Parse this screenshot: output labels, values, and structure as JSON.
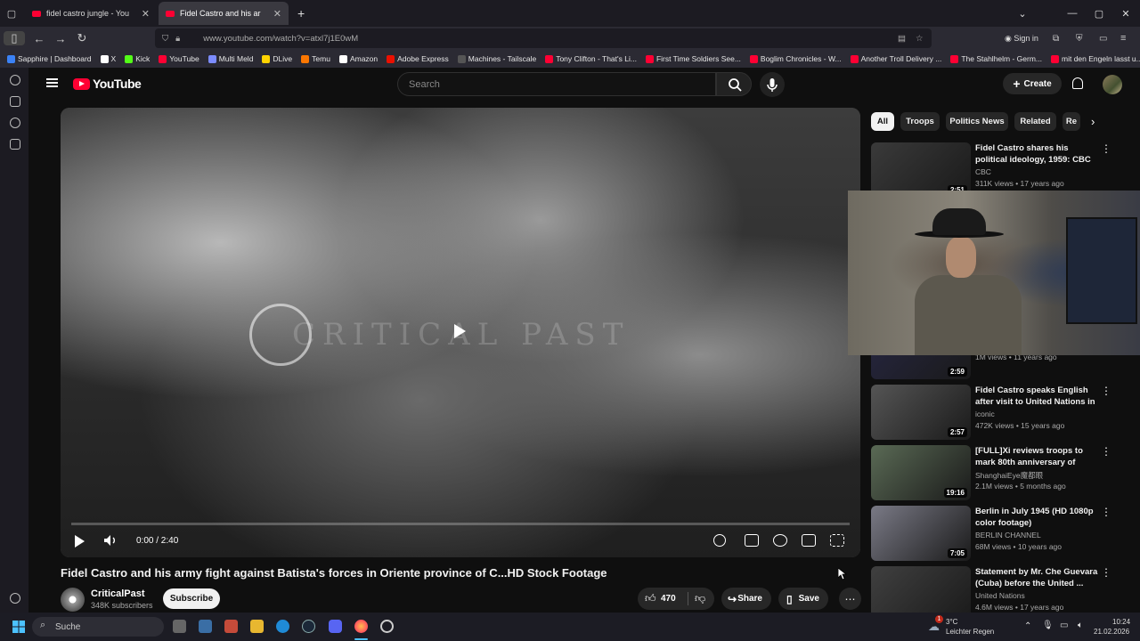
{
  "browser": {
    "tabs": [
      {
        "title": "fidel castro jungle - YouTube",
        "active": false
      },
      {
        "title": "Fidel Castro and his army fight",
        "active": true
      }
    ],
    "new_tab_label": "+",
    "url": "www.youtube.com/watch?v=atxl7j1E0wM",
    "sign_in": "Sign in",
    "bookmarks": [
      {
        "label": "Sapphire | Dashboard",
        "color": "#3b82f6"
      },
      {
        "label": "X",
        "color": "#ffffff"
      },
      {
        "label": "Kick",
        "color": "#53fc18"
      },
      {
        "label": "YouTube",
        "color": "#ff0033"
      },
      {
        "label": "Multi Meld",
        "color": "#7c8cff"
      },
      {
        "label": "DLive",
        "color": "#ffd300"
      },
      {
        "label": "Temu",
        "color": "#fb7701"
      },
      {
        "label": "Amazon",
        "color": "#ffffff"
      },
      {
        "label": "Adobe Express",
        "color": "#eb1000"
      },
      {
        "label": "Machines - Tailscale",
        "color": "#555555"
      },
      {
        "label": "Tony Clifton - That's Li...",
        "color": "#ff0033"
      },
      {
        "label": "First Time Soldiers See...",
        "color": "#ff0033"
      },
      {
        "label": "Boglim Chronicles - W...",
        "color": "#ff0033"
      },
      {
        "label": "Another Troll Delivery ...",
        "color": "#ff0033"
      },
      {
        "label": "The Stahlhelm - Germ...",
        "color": "#ff0033"
      },
      {
        "label": "mit den Engeln lasst u...",
        "color": "#ff0033"
      }
    ]
  },
  "yt": {
    "logo_text": "YouTube",
    "search_placeholder": "Search",
    "create_label": "Create",
    "accent": "#ff0033"
  },
  "player": {
    "watermark": "CRITICAL PAST",
    "time": "0:00 / 2:40",
    "progress": 0
  },
  "video": {
    "title": "Fidel Castro and his army fight against Batista's forces in Oriente province of C...HD Stock Footage",
    "channel": "CriticalPast",
    "subscribers": "348K subscribers",
    "subscribe": "Subscribe",
    "likes": "470",
    "share": "Share",
    "save": "Save",
    "more": "⋯"
  },
  "chips": [
    "All",
    "Troops",
    "Politics News",
    "Related",
    "Re"
  ],
  "recommendations": [
    {
      "title": "Fidel Castro shares his political ideology, 1959: CBC Archives ...",
      "channel": "CBC",
      "meta": "311K views • 17 years ago",
      "duration": "2:51",
      "thumb": "#3a3a3a"
    },
    {
      "title": "",
      "channel": "",
      "meta": "1M views • 11 years ago",
      "duration": "2:59",
      "thumb": "#24243a"
    },
    {
      "title": "Fidel Castro speaks English after visit to United Nations in ...",
      "channel": "iconic",
      "meta": "472K views • 15 years ago",
      "duration": "2:57",
      "thumb": "#555555"
    },
    {
      "title": "[FULL]Xi reviews troops to mark 80th anniversary of victory ov...",
      "channel": "ShanghaiEye魔都眼",
      "meta": "2.1M views • 5 months ago",
      "duration": "19:16",
      "thumb": "#5a6a55"
    },
    {
      "title": "Berlin in July 1945 (HD 1080p color footage)",
      "channel": "BERLIN CHANNEL",
      "meta": "68M views • 10 years ago",
      "duration": "7:05",
      "thumb": "#7a7a86"
    },
    {
      "title": "Statement by Mr. Che Guevara (Cuba) before the United ...",
      "channel": "United Nations",
      "meta": "4.6M views • 17 years ago",
      "duration": "",
      "thumb": "#404040"
    }
  ],
  "taskbar": {
    "search": "Suche",
    "weather_temp": "3°C",
    "weather_text": "Leichter Regen",
    "weather_badge": "1",
    "time": "10:24",
    "date": "21.02.2026"
  }
}
